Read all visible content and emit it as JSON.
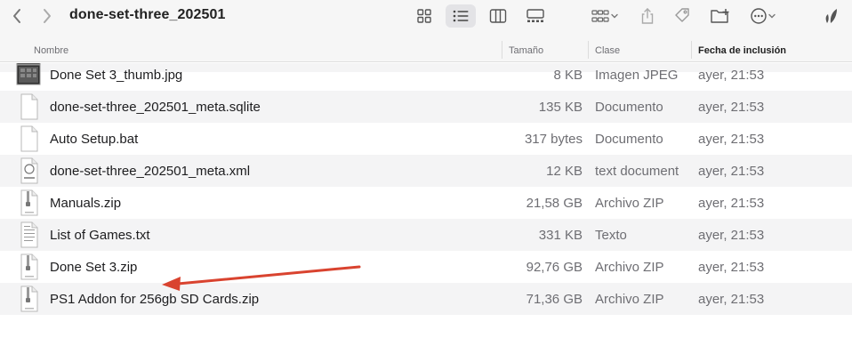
{
  "window": {
    "title": "done-set-three_202501"
  },
  "toolbar": {
    "back_icon": "chevron-left-icon",
    "forward_icon": "chevron-right-icon",
    "views": [
      "icon-view",
      "list-view",
      "column-view",
      "gallery-view"
    ],
    "active_view": "list-view"
  },
  "columns": {
    "name": "Nombre",
    "size": "Tamaño",
    "kind": "Clase",
    "date": "Fecha de inclusión"
  },
  "files": [
    {
      "name": "Done Set 3_thumb.jpg",
      "size": "8 KB",
      "kind": "Imagen JPEG",
      "date": "ayer, 21:53",
      "icon": "image-thumbnail-icon"
    },
    {
      "name": "done-set-three_202501_meta.sqlite",
      "size": "135 KB",
      "kind": "Documento",
      "date": "ayer, 21:53",
      "icon": "document-icon"
    },
    {
      "name": "Auto Setup.bat",
      "size": "317 bytes",
      "kind": "Documento",
      "date": "ayer, 21:53",
      "icon": "document-icon"
    },
    {
      "name": "done-set-three_202501_meta.xml",
      "size": "12 KB",
      "kind": "text document",
      "date": "ayer, 21:53",
      "icon": "text-document-icon"
    },
    {
      "name": "Manuals.zip",
      "size": "21,58 GB",
      "kind": "Archivo ZIP",
      "date": "ayer, 21:53",
      "icon": "zip-archive-icon"
    },
    {
      "name": "List of Games.txt",
      "size": "331 KB",
      "kind": "Texto",
      "date": "ayer, 21:53",
      "icon": "text-file-icon"
    },
    {
      "name": "Done Set 3.zip",
      "size": "92,76 GB",
      "kind": "Archivo ZIP",
      "date": "ayer, 21:53",
      "icon": "zip-archive-icon"
    },
    {
      "name": "PS1 Addon for 256gb SD Cards.zip",
      "size": "71,36 GB",
      "kind": "Archivo ZIP",
      "date": "ayer, 21:53",
      "icon": "zip-archive-icon"
    }
  ],
  "colors": {
    "annotation_arrow": "#d9432f",
    "toolbar_bg": "#f6f6f6",
    "alt_row": "#f4f4f5"
  }
}
